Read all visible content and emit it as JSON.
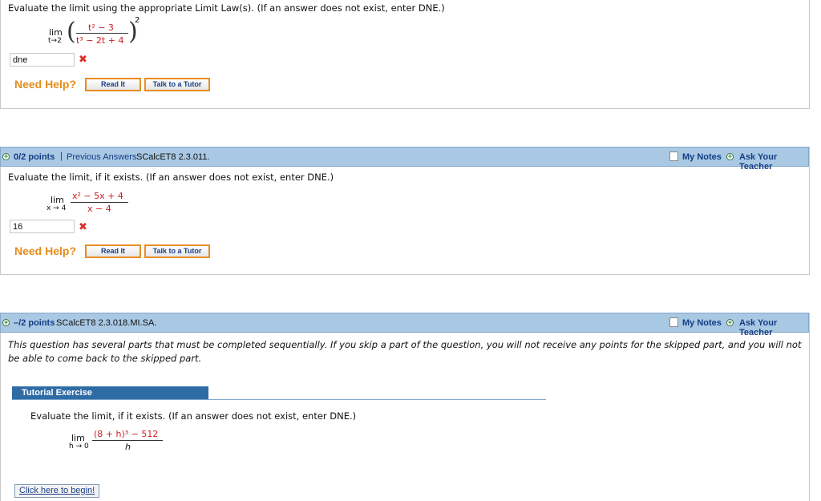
{
  "q1": {
    "prompt": "Evaluate the limit using the appropriate Limit Law(s). (If an answer does not exist, enter DNE.)",
    "lim": "lim",
    "lim_sub": "t→2",
    "numerator": "t² − 3",
    "denominator": "t³ − 2t + 4",
    "exponent": "2",
    "answer_value": "dne",
    "need_help": "Need Help?",
    "read_it": "Read It",
    "talk_tutor": "Talk to a Tutor"
  },
  "q2": {
    "points": "0/2 points",
    "separator": "|",
    "previous_answers": "Previous Answers",
    "code": "SCalcET8 2.3.011.",
    "my_notes": "My Notes",
    "ask_teacher": "Ask Your Teacher",
    "prompt": "Evaluate the limit, if it exists. (If an answer does not exist, enter DNE.)",
    "lim": "lim",
    "lim_sub": "x → 4",
    "numerator_var": "x²",
    "numerator_rest": " − 5x + 4",
    "denominator": "x − 4",
    "answer_value": "16",
    "need_help": "Need Help?",
    "read_it": "Read It",
    "talk_tutor": "Talk to a Tutor"
  },
  "q3": {
    "points": "–/2 points",
    "code": "SCalcET8 2.3.018.MI.SA.",
    "my_notes": "My Notes",
    "ask_teacher": "Ask Your Teacher",
    "note": "This question has several parts that must be completed sequentially. If you skip a part of the question, you will not receive any points for the skipped part, and you will not be able to come back to the skipped part.",
    "tutorial_label": "Tutorial Exercise",
    "prompt": "Evaluate the limit, if it exists. (If an answer does not exist, enter DNE.)",
    "lim": "lim",
    "lim_sub": "h → 0",
    "numerator_base": "(8 + h)³ − ",
    "numerator_const": "512",
    "denominator": "h",
    "begin_button": "Click here to begin!"
  },
  "colors": {
    "header_bg": "#a9c8e4",
    "link_blue": "#143d85",
    "need_help_orange": "#e68b1a",
    "error_red": "#d9302a",
    "tutorial_bar": "#2f6ca6"
  },
  "icons": [
    "expand-plus-icon",
    "wrong-answer-x-icon",
    "notes-checkbox-icon"
  ]
}
